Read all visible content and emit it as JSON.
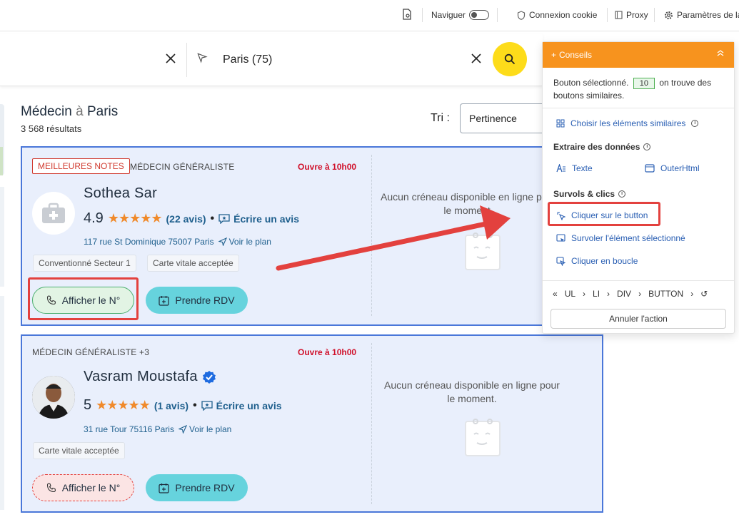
{
  "toolbar": {
    "navigate_label": "Naviguer",
    "cookie_label": "Connexion cookie",
    "proxy_label": "Proxy",
    "settings_label": "Paramètres de la"
  },
  "search": {
    "location_value": "Paris (75)"
  },
  "results": {
    "title_prefix": "Médecin",
    "title_sep": "à",
    "title_city": "Paris",
    "count": "3 568 résultats",
    "sort_label": "Tri :",
    "sort_value": "Pertinence"
  },
  "cards": [
    {
      "badge": "MEILLEURES NOTES",
      "specialty": "MÉDECIN GÉNÉRALISTE",
      "open": "Ouvre à 10h00",
      "name": "Sothea Sar",
      "rating": "4.9",
      "stars": "★★★★★",
      "reviews": "(22 avis)",
      "write_review": "Écrire un avis",
      "address": "117 rue St Dominique 75007 Paris",
      "map_link": "Voir le plan",
      "chips": [
        "Conventionné Secteur 1",
        "Carte vitale acceptée"
      ],
      "phone_button": "Afficher le N°",
      "rdv_button": "Prendre RDV",
      "no_slot": "Aucun créneau disponible en ligne pour le moment."
    },
    {
      "badge": "",
      "specialty": "MÉDECIN GÉNÉRALISTE +3",
      "open": "Ouvre à 10h00",
      "name": "Vasram Moustafa",
      "rating": "5",
      "stars": "★★★★★",
      "reviews": "(1 avis)",
      "write_review": "Écrire un avis",
      "address": "31 rue Tour 75116 Paris",
      "map_link": "Voir le plan",
      "chips": [
        "Carte vitale acceptée"
      ],
      "phone_button": "Afficher le N°",
      "rdv_button": "Prendre RDV",
      "no_slot": "Aucun créneau disponible en ligne pour le moment."
    }
  ],
  "panel": {
    "title": "Conseils",
    "selected_text_before": "Bouton sélectionné.",
    "selected_count": "10",
    "selected_text_after": "on trouve des boutons similaires.",
    "choose_similar": "Choisir les éléments similaires",
    "extract_title": "Extraire des données",
    "extract_text": "Texte",
    "extract_outer": "OuterHtml",
    "hover_title": "Survols & clics",
    "click_button": "Cliquer sur le button",
    "hover_selected": "Survoler l'élément sélectionné",
    "click_loop": "Cliquer en boucle",
    "crumbs": [
      "UL",
      "LI",
      "DIV",
      "BUTTON"
    ],
    "cancel": "Annuler l'action"
  },
  "colors": {
    "accent_orange": "#f7931e",
    "card_border": "#4a77d9",
    "card_bg": "#e9effc",
    "rdv_button": "#66d3dd",
    "search_button": "#fddc1a",
    "highlight_red": "#e3413e",
    "link_blue": "#2a5fb3"
  }
}
